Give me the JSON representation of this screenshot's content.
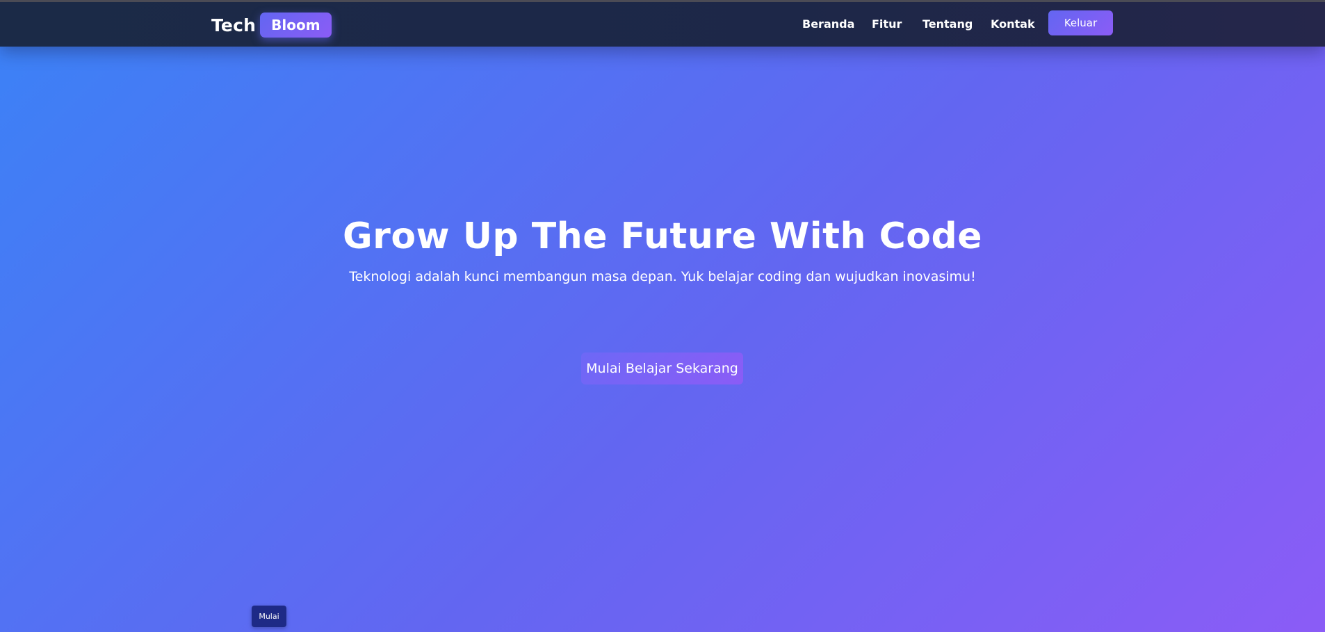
{
  "navbar": {
    "brand": {
      "primary": "Tech",
      "badge": "Bloom"
    },
    "links": [
      {
        "label": "Beranda"
      },
      {
        "label": "Fitur"
      },
      {
        "label": "Tentang"
      },
      {
        "label": "Kontak"
      }
    ],
    "logout_label": "Keluar"
  },
  "hero": {
    "title": "Grow Up The Future With Code",
    "subtitle": "Teknologi adalah kunci membangun masa depan. Yuk belajar coding dan wujudkan inovasimu!",
    "cta_label": "Mulai Belajar Sekarang"
  },
  "floating_button": {
    "label": "Mulai"
  },
  "colors": {
    "navbar_bg": "#1b2a47",
    "gradient_start": "#3b82f6",
    "gradient_mid": "#6366f1",
    "gradient_end": "#8b5cf6",
    "accent": "#8b5cf6",
    "floating_button_bg": "#1e2a86"
  }
}
